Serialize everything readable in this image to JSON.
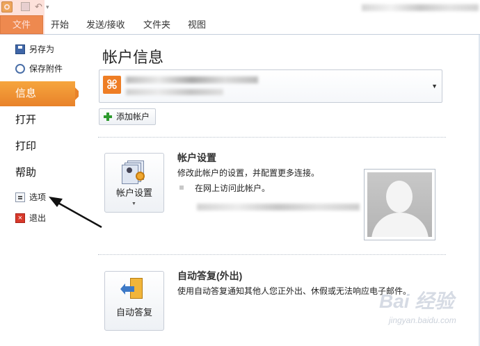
{
  "ribbon": {
    "tabs": [
      {
        "label": "文件",
        "active": true
      },
      {
        "label": "开始"
      },
      {
        "label": "发送/接收"
      },
      {
        "label": "文件夹"
      },
      {
        "label": "视图"
      }
    ]
  },
  "nav": {
    "save_as": "另存为",
    "save_attachments": "保存附件",
    "info": "信息",
    "open": "打开",
    "print": "打印",
    "help": "帮助",
    "options": "选项",
    "exit": "退出"
  },
  "main": {
    "title": "帐户信息",
    "add_account": "添加帐户",
    "account_settings": {
      "button_label": "帐户设置",
      "title": "帐户设置",
      "description": "修改此帐户的设置，并配置更多连接。",
      "bullet": "在网上访问此帐户。"
    },
    "auto_reply": {
      "button_label": "自动答复",
      "title": "自动答复(外出)",
      "description": "使用自动答复通知其他人您正外出、休假或无法响应电子邮件。"
    }
  },
  "watermark": {
    "brand": "Bai 经验",
    "url": "jingyan.baidu.com"
  },
  "colors": {
    "accent_orange": "#e8782a",
    "panel_border": "#c6ccd6"
  }
}
